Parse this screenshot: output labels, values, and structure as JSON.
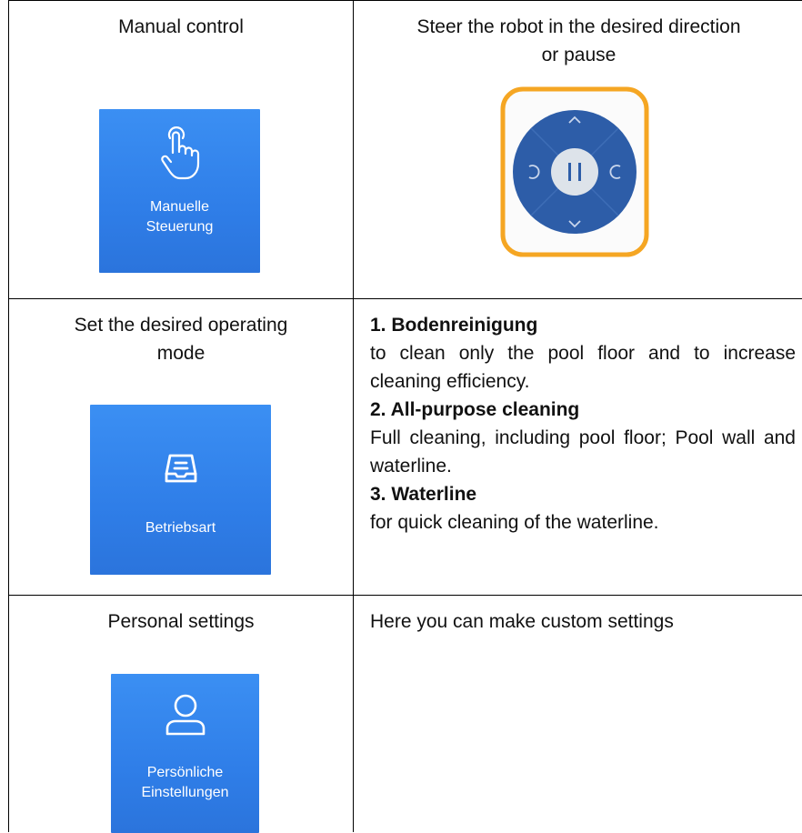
{
  "rows": [
    {
      "left_title": "Manual control",
      "tile_label_line1": "Manuelle",
      "tile_label_line2": "Steuerung",
      "tile_icon": "hand-pointer-icon",
      "right_text_line1": "Steer the robot in the desired direction",
      "right_text_line2": "or pause",
      "dpad": {
        "up": "^",
        "down": "v",
        "rotate_left": "↺",
        "rotate_right": "↻",
        "pause": "II",
        "ring_color": "#f5a623",
        "pad_color": "#2d5da8"
      }
    },
    {
      "left_title_line1": "Set the desired operating",
      "left_title_line2": "mode",
      "tile_label": "Betriebsart",
      "tile_icon": "tray-icon",
      "modes": [
        {
          "title": "1. Bodenreinigung",
          "desc": "to clean only the pool floor and to increase cleaning efficiency."
        },
        {
          "title": "2. All-purpose cleaning",
          "desc": "Full cleaning, including pool floor; Pool wall and waterline."
        },
        {
          "title": "3. Waterline",
          "desc": "for quick cleaning of the waterline."
        }
      ]
    },
    {
      "left_title": "Personal settings",
      "tile_label_line1": "Persönliche",
      "tile_label_line2": "Einstellungen",
      "tile_icon": "user-icon",
      "right_text": "Here you can make custom settings"
    }
  ],
  "colors": {
    "tile_blue": "#3b8ff3",
    "border": "#000000"
  }
}
